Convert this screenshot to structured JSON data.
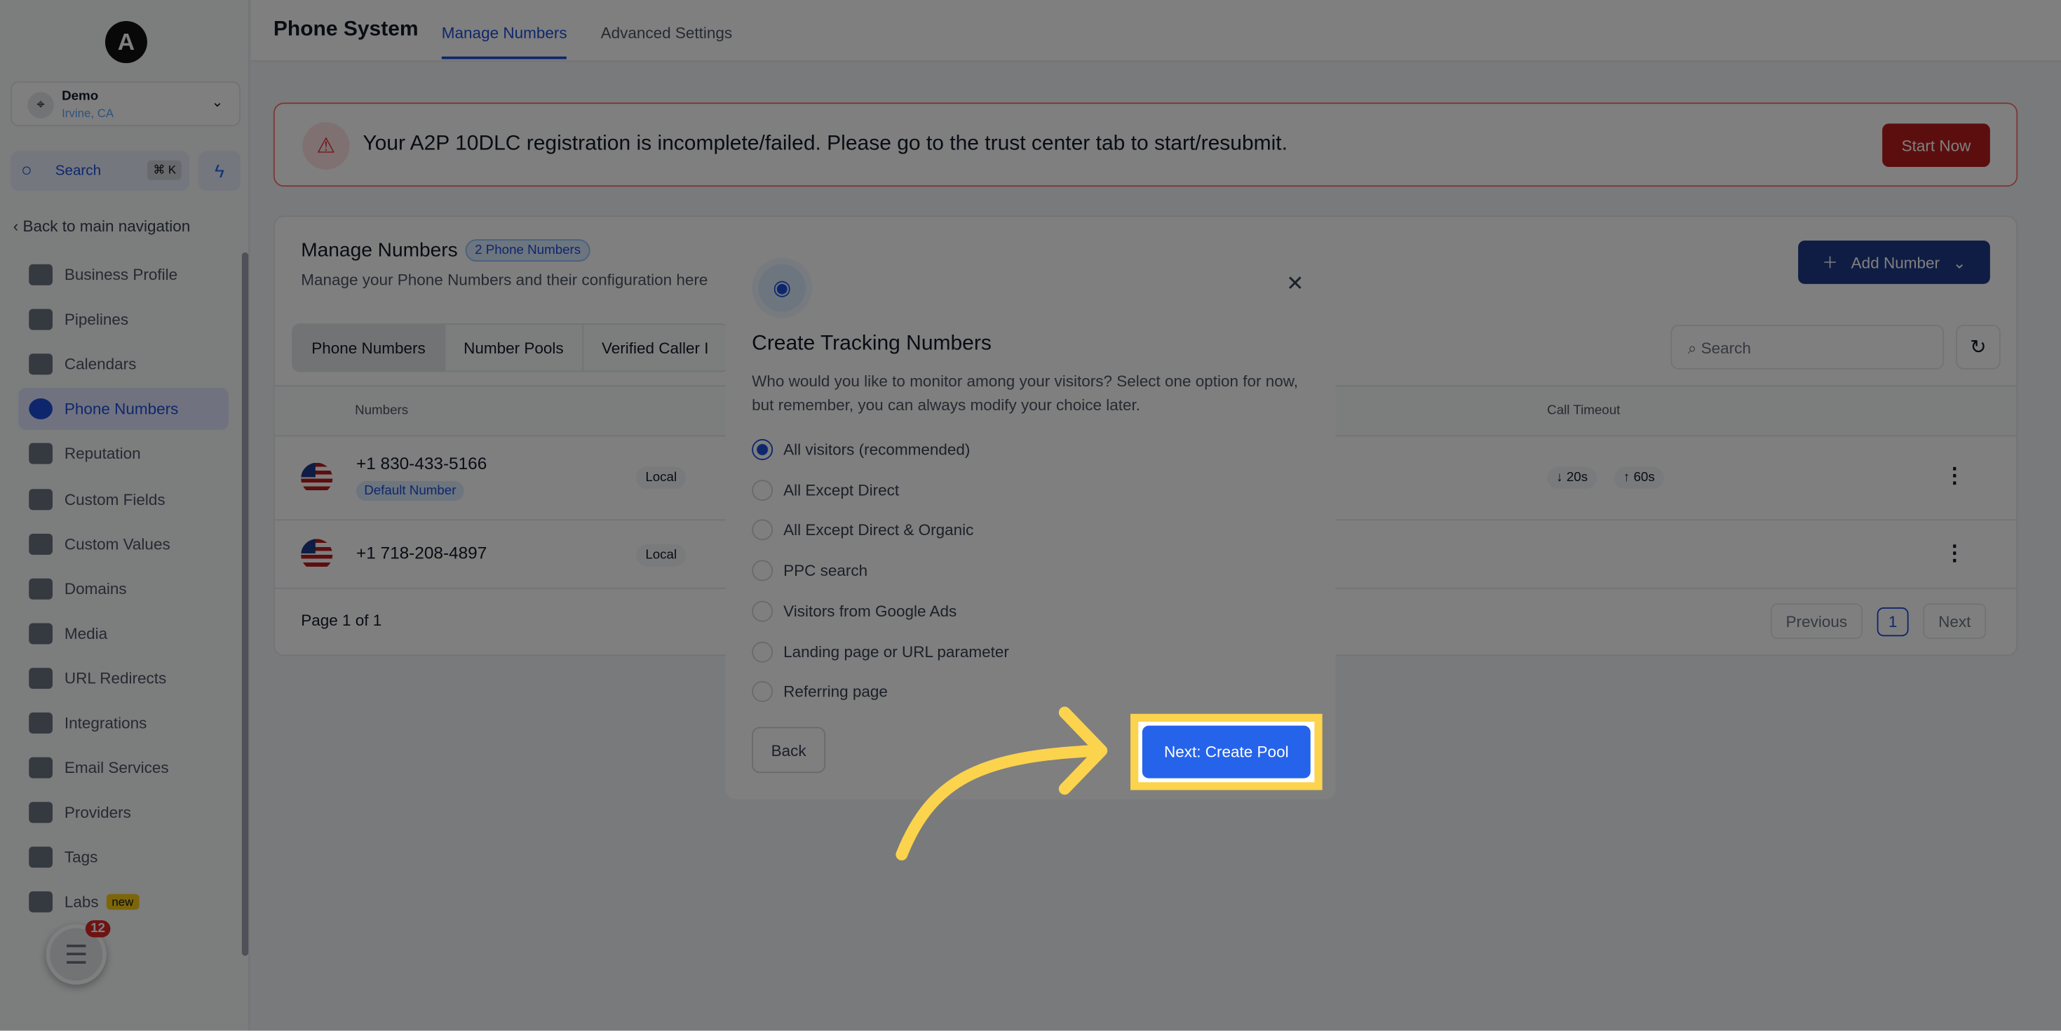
{
  "sidebar": {
    "logo": "A",
    "account": {
      "name": "Demo",
      "location": "Irvine, CA"
    },
    "search_label": "Search",
    "search_shortcut": "⌘ K",
    "back_label": "Back to main navigation",
    "items": [
      {
        "label": "Business Profile"
      },
      {
        "label": "Pipelines"
      },
      {
        "label": "Calendars"
      },
      {
        "label": "Phone Numbers",
        "active": true
      },
      {
        "label": "Reputation"
      },
      {
        "label": "Custom Fields"
      },
      {
        "label": "Custom Values"
      },
      {
        "label": "Domains"
      },
      {
        "label": "Media"
      },
      {
        "label": "URL Redirects"
      },
      {
        "label": "Integrations"
      },
      {
        "label": "Email Services"
      },
      {
        "label": "Providers"
      },
      {
        "label": "Tags"
      },
      {
        "label": "Labs",
        "badge": "new"
      }
    ],
    "chat_badge": "12"
  },
  "header": {
    "title": "Phone System",
    "tabs": [
      {
        "label": "Manage Numbers",
        "active": true
      },
      {
        "label": "Advanced Settings"
      }
    ]
  },
  "alert": {
    "message": "Your A2P 10DLC registration is incomplete/failed. Please go to the trust center tab to start/resubmit.",
    "button": "Start Now"
  },
  "card": {
    "title": "Manage Numbers",
    "count_badge": "2 Phone Numbers",
    "subtitle": "Manage your Phone Numbers and their configuration here",
    "add_button": "Add Number",
    "tabs": [
      "Phone Numbers",
      "Number Pools",
      "Verified Caller I"
    ],
    "search_placeholder": "Search",
    "columns": [
      "Numbers",
      "Call Timeout"
    ],
    "rows": [
      {
        "number": "+1 830-433-5166",
        "badge": "Default Number",
        "type": "Local",
        "timeout_in": "↓ 20s",
        "timeout_out": "↑ 60s"
      },
      {
        "number": "+1 718-208-4897",
        "type": "Local"
      }
    ],
    "pagination": {
      "label": "Page 1 of 1",
      "previous": "Previous",
      "page": "1",
      "next": "Next"
    }
  },
  "modal": {
    "title": "Create Tracking Numbers",
    "description": "Who would you like to monitor among your visitors? Select one option for now, but remember, you can always modify your choice later.",
    "options": [
      "All visitors (recommended)",
      "All Except Direct",
      "All Except Direct & Organic",
      "PPC search",
      "Visitors from Google Ads",
      "Landing page or URL parameter",
      "Referring page"
    ],
    "selected": "All visitors (recommended)",
    "back": "Back",
    "next": "Next: Create Pool"
  },
  "colors": {
    "accent": "#2563eb",
    "highlight": "#fcd34d",
    "alert": "#b91c1c"
  }
}
